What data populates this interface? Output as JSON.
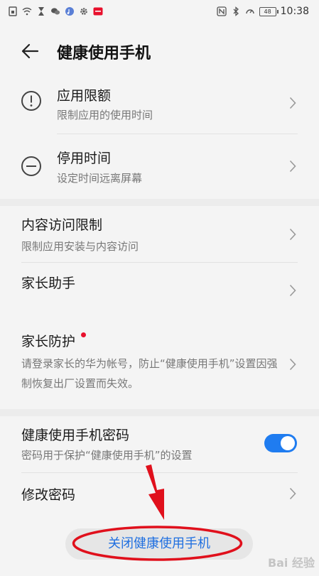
{
  "status_bar": {
    "time": "10:38",
    "battery": "48"
  },
  "header": {
    "title": "健康使用手机"
  },
  "items": [
    {
      "title": "应用限额",
      "subtitle": "限制应用的使用时间"
    },
    {
      "title": "停用时间",
      "subtitle": "设定时间远离屏幕"
    },
    {
      "title": "内容访问限制",
      "subtitle": "限制应用安装与内容访问"
    },
    {
      "title": "家长助手"
    },
    {
      "title": "家长防护",
      "subtitle": "请登录家长的华为帐号，防止“健康使用手机”设置因强制恢复出厂设置而失效。"
    },
    {
      "title": "健康使用手机密码",
      "subtitle": "密码用于保护“健康使用手机”的设置",
      "toggle_on": true
    },
    {
      "title": "修改密码"
    }
  ],
  "bottom_button": {
    "label": "关闭健康使用手机"
  },
  "annotation_color": "#e0101c",
  "accent_color": "#1f7cf0"
}
